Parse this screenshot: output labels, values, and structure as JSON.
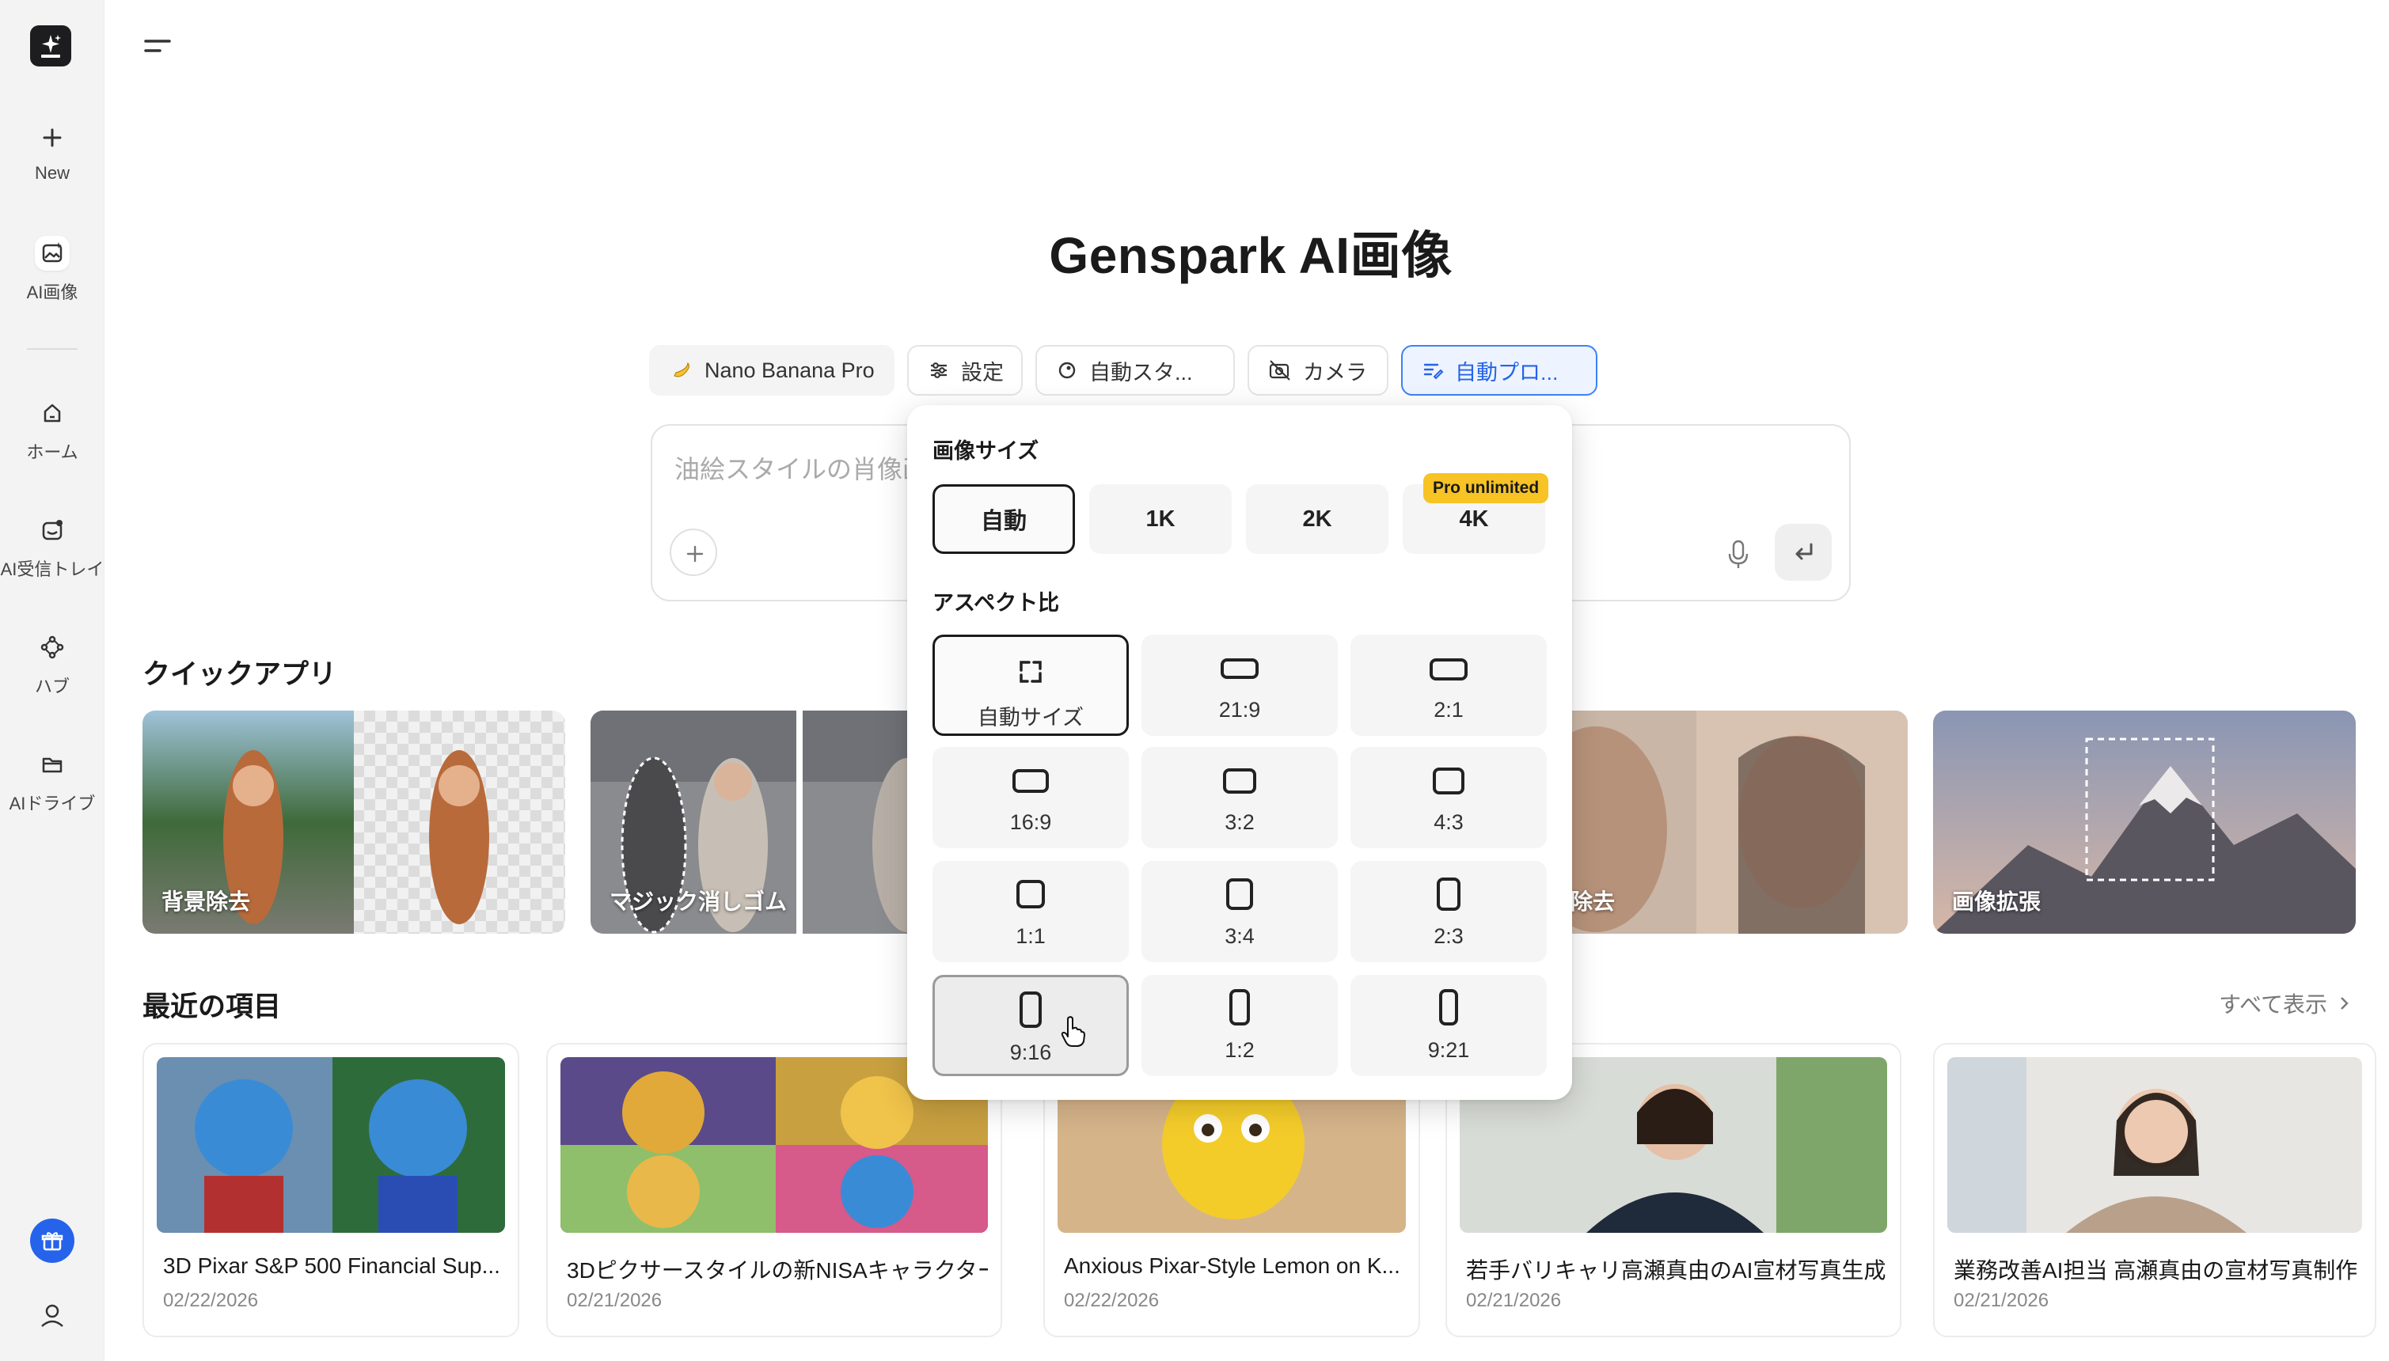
{
  "app": {
    "title": "Genspark AI画像"
  },
  "sidebar": {
    "items": [
      {
        "label": "New",
        "icon": "plus-icon"
      },
      {
        "label": "AI画像",
        "icon": "ai-image-icon"
      },
      {
        "label": "ホーム",
        "icon": "home-icon"
      },
      {
        "label": "AI受信トレイ",
        "icon": "inbox-icon"
      },
      {
        "label": "ハブ",
        "icon": "hub-icon"
      },
      {
        "label": "AIドライブ",
        "icon": "folder-icon"
      }
    ]
  },
  "toolbar": {
    "model": "Nano Banana Pro",
    "settings": "設定",
    "style": "自動スタ...",
    "camera": "カメラ",
    "prompt_mode": "自動プロ..."
  },
  "prompt": {
    "placeholder": "油絵スタイルの肖像画"
  },
  "popover": {
    "size_heading": "画像サイズ",
    "sizes": [
      "自動",
      "1K",
      "2K",
      "4K"
    ],
    "selected_size": "自動",
    "pro_badge": "Pro unlimited",
    "aspect_heading": "アスペクト比",
    "aspects": [
      "自動サイズ",
      "21:9",
      "2:1",
      "16:9",
      "3:2",
      "4:3",
      "1:1",
      "3:4",
      "2:3",
      "9:16",
      "1:2",
      "9:21"
    ],
    "selected_aspect": "自動サイズ",
    "hover_aspect": "9:16"
  },
  "quick_apps": {
    "title": "クイックアプリ",
    "items": [
      "背景除去",
      "マジック消しゴム",
      "ぼかし除去",
      "画像拡張"
    ]
  },
  "recent": {
    "title": "最近の項目",
    "view_all": "すべて表示",
    "items": [
      {
        "title": "3D Pixar S&P 500 Financial Sup...",
        "date": "02/22/2026"
      },
      {
        "title": "3Dピクサースタイルの新NISAキャラクター",
        "date": "02/21/2026"
      },
      {
        "title": "Anxious Pixar-Style Lemon on K...",
        "date": "02/22/2026"
      },
      {
        "title": "若手バリキャリ高瀬真由のAI宣材写真生成",
        "date": "02/21/2026"
      },
      {
        "title": "業務改善AI担当 高瀬真由の宣材写真制作",
        "date": "02/21/2026"
      }
    ]
  },
  "colors": {
    "accent": "#2563eb",
    "badge": "#f7c325"
  }
}
